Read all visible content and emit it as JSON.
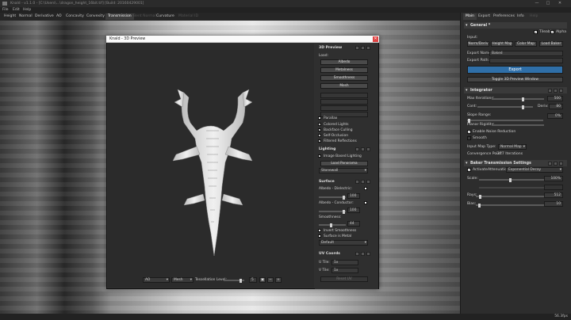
{
  "window": {
    "title": "Knald - v1.1.0 - [C:\\Users\\...\\dragon_height_16bit.tif] [Build: 20160429001]",
    "min": "—",
    "max": "□",
    "close": "✕"
  },
  "menu": [
    "File",
    "Edit",
    "Help"
  ],
  "main_tabs": [
    {
      "label": "Height",
      "state": "normal"
    },
    {
      "label": "Normal",
      "state": "normal"
    },
    {
      "label": "Derivative",
      "state": "normal"
    },
    {
      "label": "AO",
      "state": "normal"
    },
    {
      "label": "Concavity",
      "state": "normal"
    },
    {
      "label": "Convexity",
      "state": "normal"
    },
    {
      "label": "Transmission",
      "state": "active"
    },
    {
      "label": "Bent Normal",
      "state": "dim"
    },
    {
      "label": "Curvature",
      "state": "normal"
    },
    {
      "label": "Material ID",
      "state": "dim"
    }
  ],
  "right_tabs": [
    {
      "label": "Main",
      "state": "active"
    },
    {
      "label": "Export",
      "state": "normal"
    },
    {
      "label": "Preferences",
      "state": "normal"
    },
    {
      "label": "Info",
      "state": "normal"
    },
    {
      "label": "Help",
      "state": "dim"
    }
  ],
  "general": {
    "title": "General *",
    "tileable": "Tileable",
    "alpha": "Alpha",
    "input_label": "Input:",
    "btn_norm": "Norm/Deriv",
    "btn_height": "Height Map",
    "btn_color": "Color Map",
    "btn_baker": "Load Baker",
    "export_name_label": "Export Name:",
    "export_name_value": "Baked",
    "export_path_label": "Export Path:",
    "export_btn": "Export",
    "toggle_btn": "Toggle 3D Preview Window"
  },
  "integrator": {
    "title": "Integrator",
    "max_iter_label": "Max Iterations:",
    "max_iter_value": "500",
    "cont_label": "Cont:",
    "cont_value": "",
    "deriv_label": "Deriv:",
    "deriv_value": "80",
    "slope_label": "Slope Range:",
    "slope_value": "0%",
    "planar_label": "Planar Rigidity:",
    "noise_label": "Enable Noise Reduction",
    "smooth_label": "Smooth",
    "input_map_label": "Input Map Type:",
    "input_map_value": "Normal Map",
    "conv_label": "Convergence Point:",
    "conv_value": "277 Iterations"
  },
  "baker": {
    "title": "Baker Transmission Settings",
    "activate": "Activate",
    "attenuation_label": "Attenuation:",
    "attenuation_value": "Exponential Decay",
    "scale_label": "Scale:",
    "scale_value": "100%",
    "rays_label": "Rays:",
    "rays_value": "512",
    "bias_label": "Bias:",
    "bias_value": "10"
  },
  "preview": {
    "title": "Knald - 3D Preview",
    "close": "✕",
    "panel_title": "3D Preview",
    "load_label": "Load:",
    "load_buttons": [
      "Albedo",
      "Metalness",
      "Smoothness",
      "Mesh"
    ],
    "dim_buttons": [
      "",
      "",
      "",
      ""
    ],
    "checks": [
      {
        "label": "Parallax",
        "on": false
      },
      {
        "label": "Colored Lights",
        "on": true
      },
      {
        "label": "Backface Culling",
        "on": true
      },
      {
        "label": "Self-Occlusion",
        "on": true
      },
      {
        "label": "Filtered Reflections",
        "on": true
      }
    ],
    "lighting_title": "Lighting",
    "ibl_label": "Image Based Lighting",
    "load_panorama": "Load Panorama",
    "panorama_value": "Stonewall",
    "surface_title": "Surface",
    "albedo_dielectric": "Albedo - Dielectric:",
    "albedo_dielectric_value": "100",
    "albedo_conductor": "Albedo - Conductor:",
    "albedo_conductor_value": "100",
    "smoothness_label": "Smoothness:",
    "smoothness_value": "44",
    "invert_smoothness": "Invert Smoothness",
    "surface_metal": "Surface is Metal",
    "surface_default": "Default",
    "uv_title": "UV Coords",
    "u_tile_label": "U Tile:",
    "u_tile_value": "1x",
    "v_tile_label": "V Tile:",
    "v_tile_value": "1x",
    "reset_uv": "Reset UV",
    "bottom_map": "AO",
    "bottom_mesh": "Mesh",
    "tess_label": "Tessellation Level:",
    "tess_value": "5"
  },
  "status": {
    "fps": "56.3fps"
  }
}
